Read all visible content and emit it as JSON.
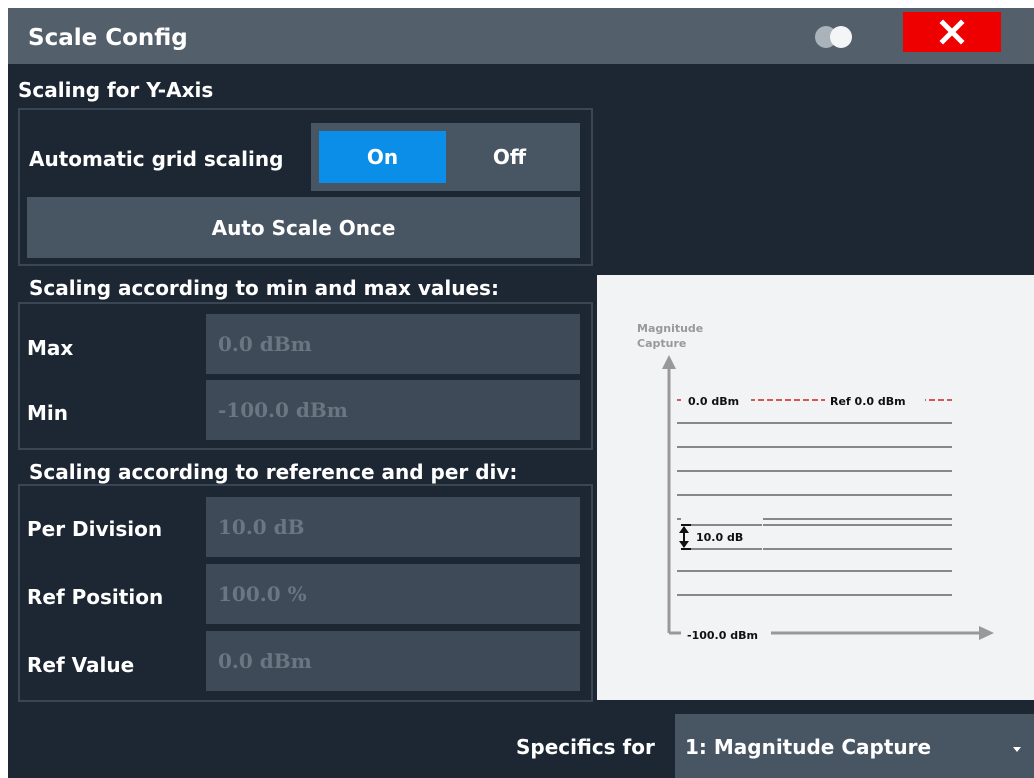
{
  "window": {
    "title": "Scale Config"
  },
  "y_axis": {
    "heading": "Scaling for Y-Axis",
    "auto_grid": {
      "label": "Automatic grid scaling",
      "on_label": "On",
      "off_label": "Off",
      "selected": "On"
    },
    "auto_scale_once_label": "Auto Scale Once"
  },
  "minmax": {
    "heading": "Scaling according to min and max values:",
    "max": {
      "label": "Max",
      "value": "0.0 dBm"
    },
    "min": {
      "label": "Min",
      "value": "-100.0 dBm"
    }
  },
  "refdiv": {
    "heading": "Scaling according to reference and per div:",
    "per_division": {
      "label": "Per Division",
      "value": "10.0 dB"
    },
    "ref_position": {
      "label": "Ref Position",
      "value": "100.0 %"
    },
    "ref_value": {
      "label": "Ref Value",
      "value": "0.0 dBm"
    }
  },
  "preview": {
    "axis_title_line1": "Magnitude",
    "axis_title_line2": "Capture",
    "top_label": "0.0 dBm",
    "ref_label": "Ref 0.0 dBm",
    "div_label": "10.0 dB",
    "bottom_label": "-100.0 dBm",
    "ref_line_color": "#cc2222"
  },
  "footer": {
    "specifics_label": "Specifics for",
    "selected_window": "1: Magnitude Capture"
  },
  "colors": {
    "accent": "#0a8ee8",
    "close": "#ee0000",
    "background": "#1d2733"
  }
}
